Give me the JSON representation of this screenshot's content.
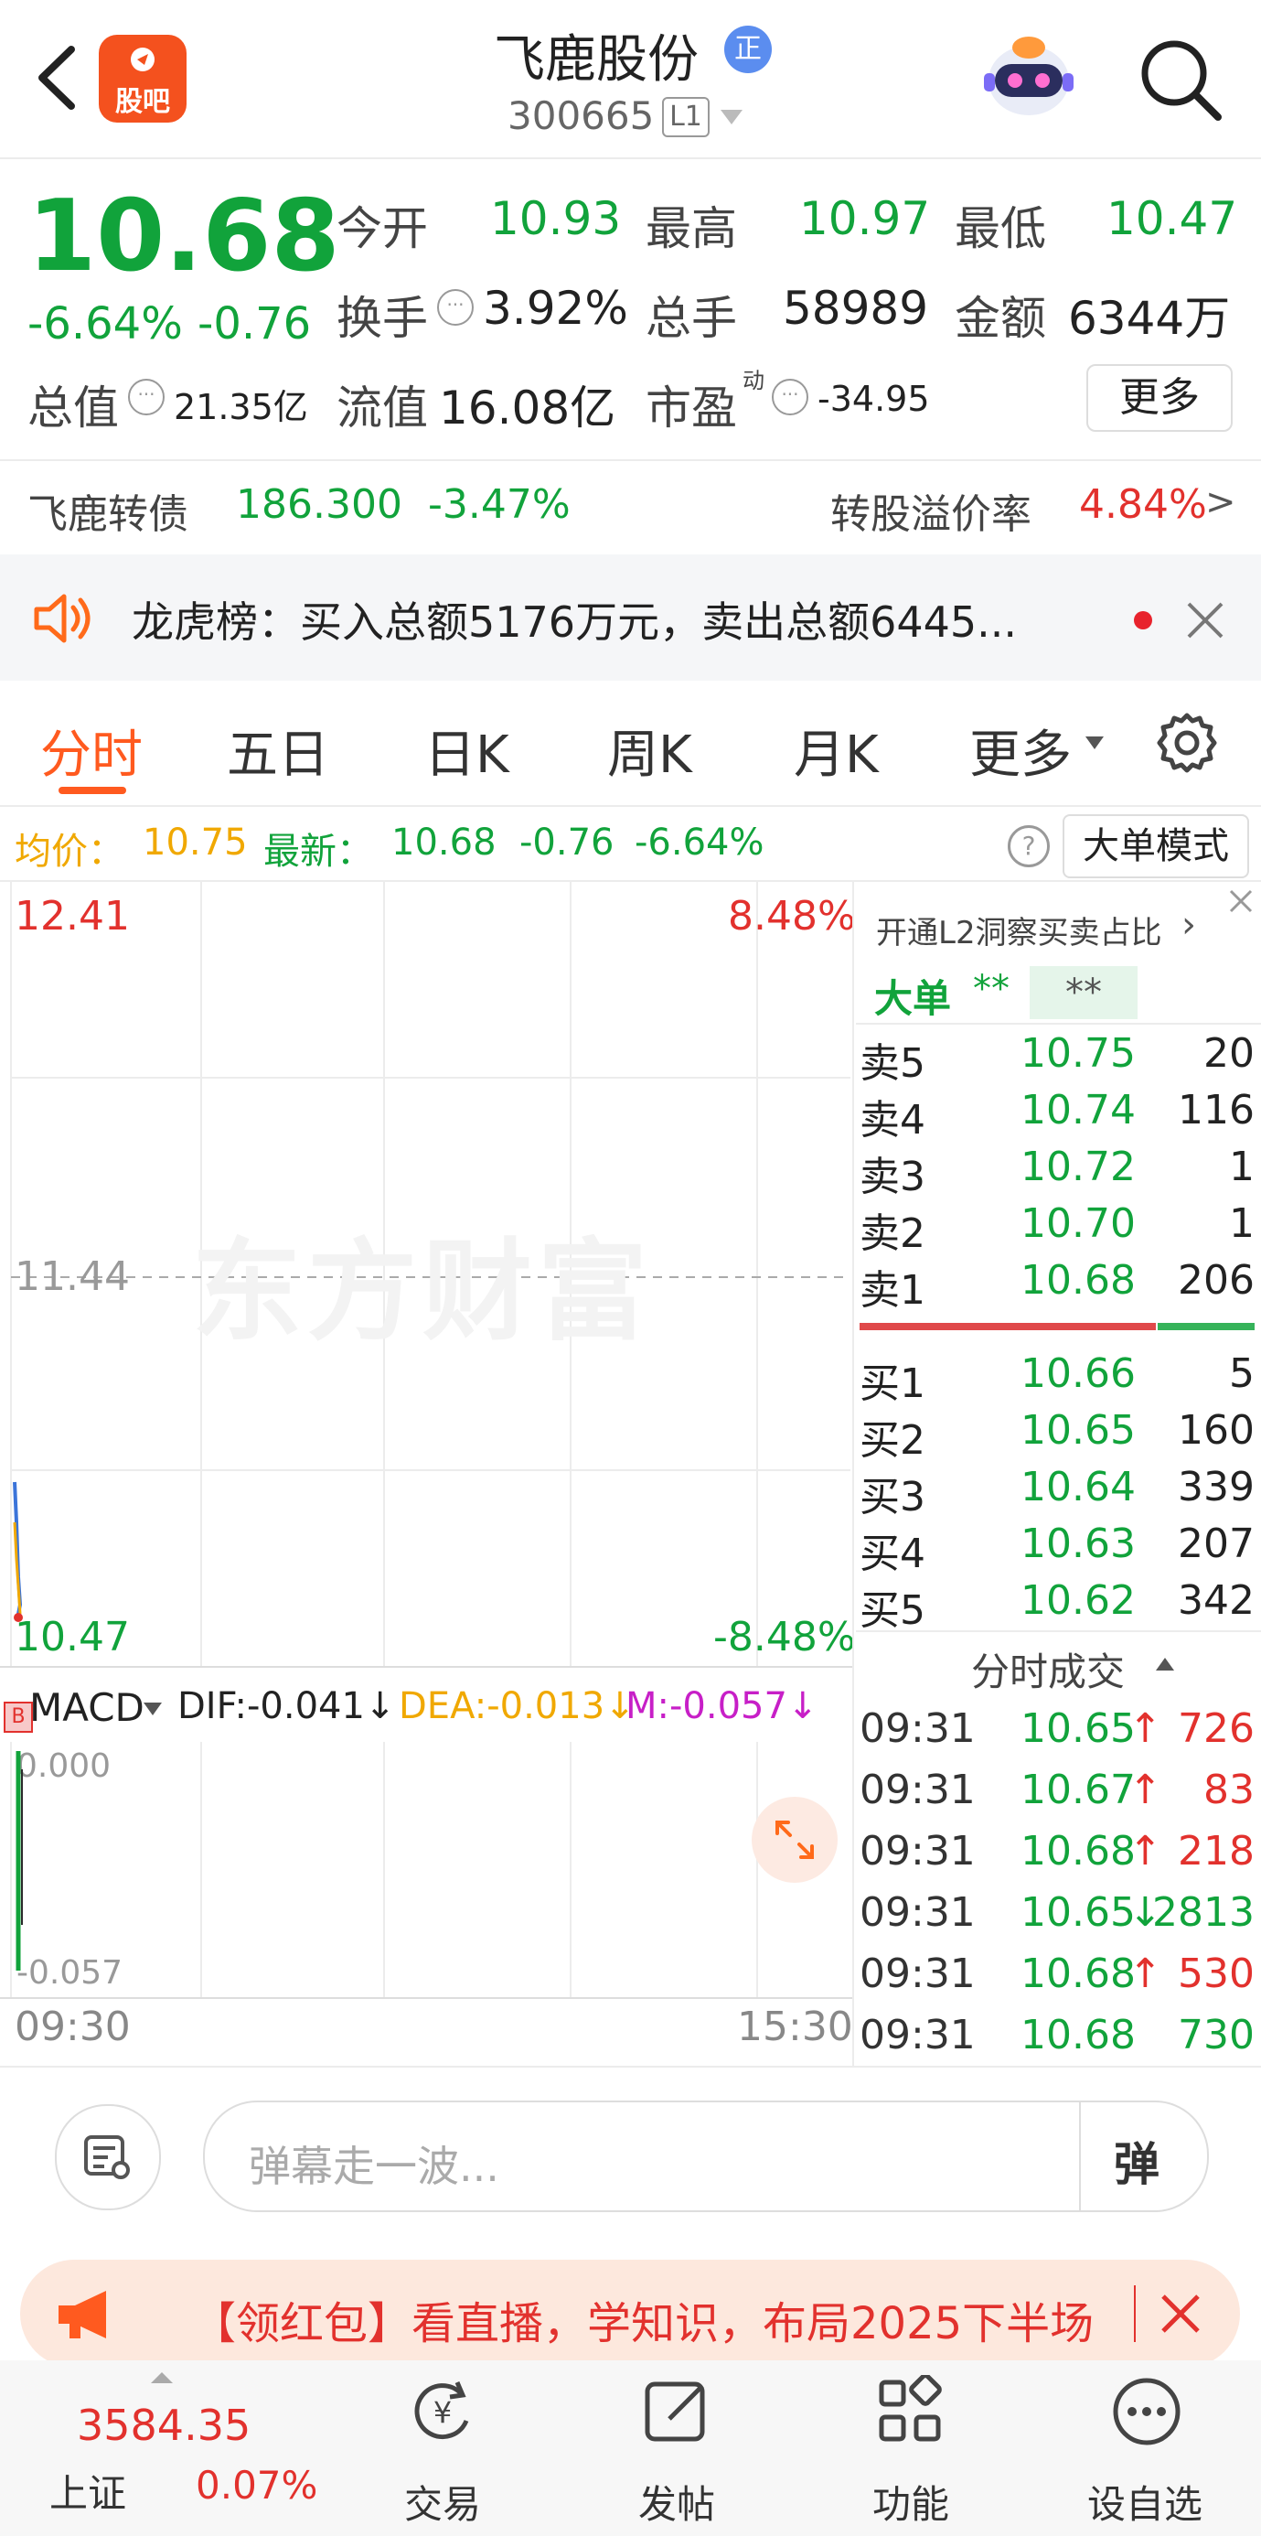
{
  "header": {
    "title": "飞鹿股份",
    "badge": "正",
    "code": "300665",
    "level": "L1",
    "guba_label": "股吧"
  },
  "quote": {
    "price": "10.68",
    "change_pct": "-6.64%",
    "change": "-0.76",
    "open_label": "今开",
    "open": "10.93",
    "high_label": "最高",
    "high": "10.97",
    "low_label": "最低",
    "low": "10.47",
    "turnover_label": "换手",
    "turnover": "3.92%",
    "volume_label": "总手",
    "volume": "58989",
    "amount_label": "金额",
    "amount": "6344万",
    "mktcap_label": "总值",
    "mktcap": "21.35亿",
    "float_label": "流值",
    "float": "16.08亿",
    "pe_label": "市盈",
    "pe_sup": "动",
    "pe": "-34.95",
    "more_label": "更多"
  },
  "bond": {
    "name": "飞鹿转债",
    "price": "186.300",
    "change_pct": "-3.47%",
    "premium_label": "转股溢价率",
    "premium": "4.84%",
    "arrow": ">"
  },
  "notice": {
    "text": "龙虎榜：买入总额5176万元，卖出总额6445..."
  },
  "tabs": [
    "分时",
    "五日",
    "日K",
    "周K",
    "月K",
    "更多"
  ],
  "infobar": {
    "avg_label": "均价：",
    "avg": "10.75",
    "latest_label": "最新：",
    "latest": "10.68",
    "change": "-0.76",
    "change_pct": "-6.64%",
    "help": "?",
    "mode_button": "大单模式"
  },
  "chart": {
    "top_price": "12.41",
    "top_pct": "8.48%",
    "mid_price": "11.44",
    "bottom_price": "10.47",
    "bottom_pct": "-8.48%",
    "watermark": "东方财富",
    "time_start": "09:30",
    "time_end": "15:30"
  },
  "macd": {
    "label": "MACD",
    "dif": "DIF:-0.041",
    "dea": "DEA:-0.013",
    "m": "M:-0.057",
    "arrow": "↓",
    "top_val": "0.000",
    "bottom_val": "-0.057",
    "b_marker": "B"
  },
  "orderbook": {
    "promo": "开通L2洞察买卖占比",
    "promo_arrow": "›",
    "big_label": "大单",
    "big_val1": "**",
    "big_val2": "**",
    "asks": [
      {
        "label": "卖5",
        "price": "10.75",
        "vol": "20"
      },
      {
        "label": "卖4",
        "price": "10.74",
        "vol": "116"
      },
      {
        "label": "卖3",
        "price": "10.72",
        "vol": "1"
      },
      {
        "label": "卖2",
        "price": "10.70",
        "vol": "1"
      },
      {
        "label": "卖1",
        "price": "10.68",
        "vol": "206"
      }
    ],
    "bids": [
      {
        "label": "买1",
        "price": "10.66",
        "vol": "5"
      },
      {
        "label": "买2",
        "price": "10.65",
        "vol": "160"
      },
      {
        "label": "买3",
        "price": "10.64",
        "vol": "339"
      },
      {
        "label": "买4",
        "price": "10.63",
        "vol": "207"
      },
      {
        "label": "买5",
        "price": "10.62",
        "vol": "342"
      }
    ],
    "ticks_title": "分时成交",
    "ticks": [
      {
        "time": "09:31",
        "price": "10.65",
        "dir": "↑",
        "vol": "726",
        "color": "#e2312d"
      },
      {
        "time": "09:31",
        "price": "10.67",
        "dir": "↑",
        "vol": "83",
        "color": "#e2312d"
      },
      {
        "time": "09:31",
        "price": "10.68",
        "dir": "↑",
        "vol": "218",
        "color": "#e2312d"
      },
      {
        "time": "09:31",
        "price": "10.65",
        "dir": "↓",
        "vol": "2813",
        "color": "#11a33b"
      },
      {
        "time": "09:31",
        "price": "10.68",
        "dir": "↑",
        "vol": "530",
        "color": "#e2312d"
      },
      {
        "time": "09:31",
        "price": "10.68",
        "dir": "",
        "vol": "730",
        "color": "#11a33b"
      }
    ]
  },
  "comment": {
    "placeholder": "弹幕走一波...",
    "danmu_label": "弹"
  },
  "banner": {
    "text": "【领红包】看直播，学知识，布局2025下半场"
  },
  "bottom_nav": {
    "index_value": "3584.35",
    "index_name": "上证",
    "index_pct": "0.07%",
    "items": [
      "交易",
      "发帖",
      "功能",
      "设自选"
    ]
  },
  "colors": {
    "up": "#e2312d",
    "down": "#11a33b",
    "accent": "#ff5a1f",
    "avg": "#f0a800",
    "macd_m": "#c71fc7"
  }
}
